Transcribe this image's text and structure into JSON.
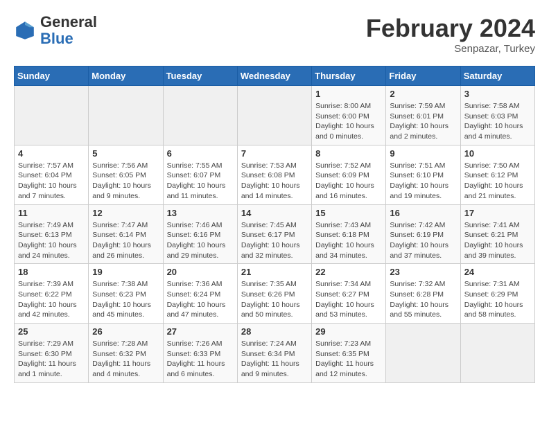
{
  "logo": {
    "general": "General",
    "blue": "Blue"
  },
  "header": {
    "month_year": "February 2024",
    "location": "Senpazar, Turkey"
  },
  "weekdays": [
    "Sunday",
    "Monday",
    "Tuesday",
    "Wednesday",
    "Thursday",
    "Friday",
    "Saturday"
  ],
  "weeks": [
    [
      null,
      null,
      null,
      null,
      {
        "num": "1",
        "sunrise": "8:00 AM",
        "sunset": "6:00 PM",
        "daylight": "10 hours and 0 minutes."
      },
      {
        "num": "2",
        "sunrise": "7:59 AM",
        "sunset": "6:01 PM",
        "daylight": "10 hours and 2 minutes."
      },
      {
        "num": "3",
        "sunrise": "7:58 AM",
        "sunset": "6:03 PM",
        "daylight": "10 hours and 4 minutes."
      }
    ],
    [
      {
        "num": "4",
        "sunrise": "7:57 AM",
        "sunset": "6:04 PM",
        "daylight": "10 hours and 7 minutes."
      },
      {
        "num": "5",
        "sunrise": "7:56 AM",
        "sunset": "6:05 PM",
        "daylight": "10 hours and 9 minutes."
      },
      {
        "num": "6",
        "sunrise": "7:55 AM",
        "sunset": "6:07 PM",
        "daylight": "10 hours and 11 minutes."
      },
      {
        "num": "7",
        "sunrise": "7:53 AM",
        "sunset": "6:08 PM",
        "daylight": "10 hours and 14 minutes."
      },
      {
        "num": "8",
        "sunrise": "7:52 AM",
        "sunset": "6:09 PM",
        "daylight": "10 hours and 16 minutes."
      },
      {
        "num": "9",
        "sunrise": "7:51 AM",
        "sunset": "6:10 PM",
        "daylight": "10 hours and 19 minutes."
      },
      {
        "num": "10",
        "sunrise": "7:50 AM",
        "sunset": "6:12 PM",
        "daylight": "10 hours and 21 minutes."
      }
    ],
    [
      {
        "num": "11",
        "sunrise": "7:49 AM",
        "sunset": "6:13 PM",
        "daylight": "10 hours and 24 minutes."
      },
      {
        "num": "12",
        "sunrise": "7:47 AM",
        "sunset": "6:14 PM",
        "daylight": "10 hours and 26 minutes."
      },
      {
        "num": "13",
        "sunrise": "7:46 AM",
        "sunset": "6:16 PM",
        "daylight": "10 hours and 29 minutes."
      },
      {
        "num": "14",
        "sunrise": "7:45 AM",
        "sunset": "6:17 PM",
        "daylight": "10 hours and 32 minutes."
      },
      {
        "num": "15",
        "sunrise": "7:43 AM",
        "sunset": "6:18 PM",
        "daylight": "10 hours and 34 minutes."
      },
      {
        "num": "16",
        "sunrise": "7:42 AM",
        "sunset": "6:19 PM",
        "daylight": "10 hours and 37 minutes."
      },
      {
        "num": "17",
        "sunrise": "7:41 AM",
        "sunset": "6:21 PM",
        "daylight": "10 hours and 39 minutes."
      }
    ],
    [
      {
        "num": "18",
        "sunrise": "7:39 AM",
        "sunset": "6:22 PM",
        "daylight": "10 hours and 42 minutes."
      },
      {
        "num": "19",
        "sunrise": "7:38 AM",
        "sunset": "6:23 PM",
        "daylight": "10 hours and 45 minutes."
      },
      {
        "num": "20",
        "sunrise": "7:36 AM",
        "sunset": "6:24 PM",
        "daylight": "10 hours and 47 minutes."
      },
      {
        "num": "21",
        "sunrise": "7:35 AM",
        "sunset": "6:26 PM",
        "daylight": "10 hours and 50 minutes."
      },
      {
        "num": "22",
        "sunrise": "7:34 AM",
        "sunset": "6:27 PM",
        "daylight": "10 hours and 53 minutes."
      },
      {
        "num": "23",
        "sunrise": "7:32 AM",
        "sunset": "6:28 PM",
        "daylight": "10 hours and 55 minutes."
      },
      {
        "num": "24",
        "sunrise": "7:31 AM",
        "sunset": "6:29 PM",
        "daylight": "10 hours and 58 minutes."
      }
    ],
    [
      {
        "num": "25",
        "sunrise": "7:29 AM",
        "sunset": "6:30 PM",
        "daylight": "11 hours and 1 minute."
      },
      {
        "num": "26",
        "sunrise": "7:28 AM",
        "sunset": "6:32 PM",
        "daylight": "11 hours and 4 minutes."
      },
      {
        "num": "27",
        "sunrise": "7:26 AM",
        "sunset": "6:33 PM",
        "daylight": "11 hours and 6 minutes."
      },
      {
        "num": "28",
        "sunrise": "7:24 AM",
        "sunset": "6:34 PM",
        "daylight": "11 hours and 9 minutes."
      },
      {
        "num": "29",
        "sunrise": "7:23 AM",
        "sunset": "6:35 PM",
        "daylight": "11 hours and 12 minutes."
      },
      null,
      null
    ]
  ]
}
